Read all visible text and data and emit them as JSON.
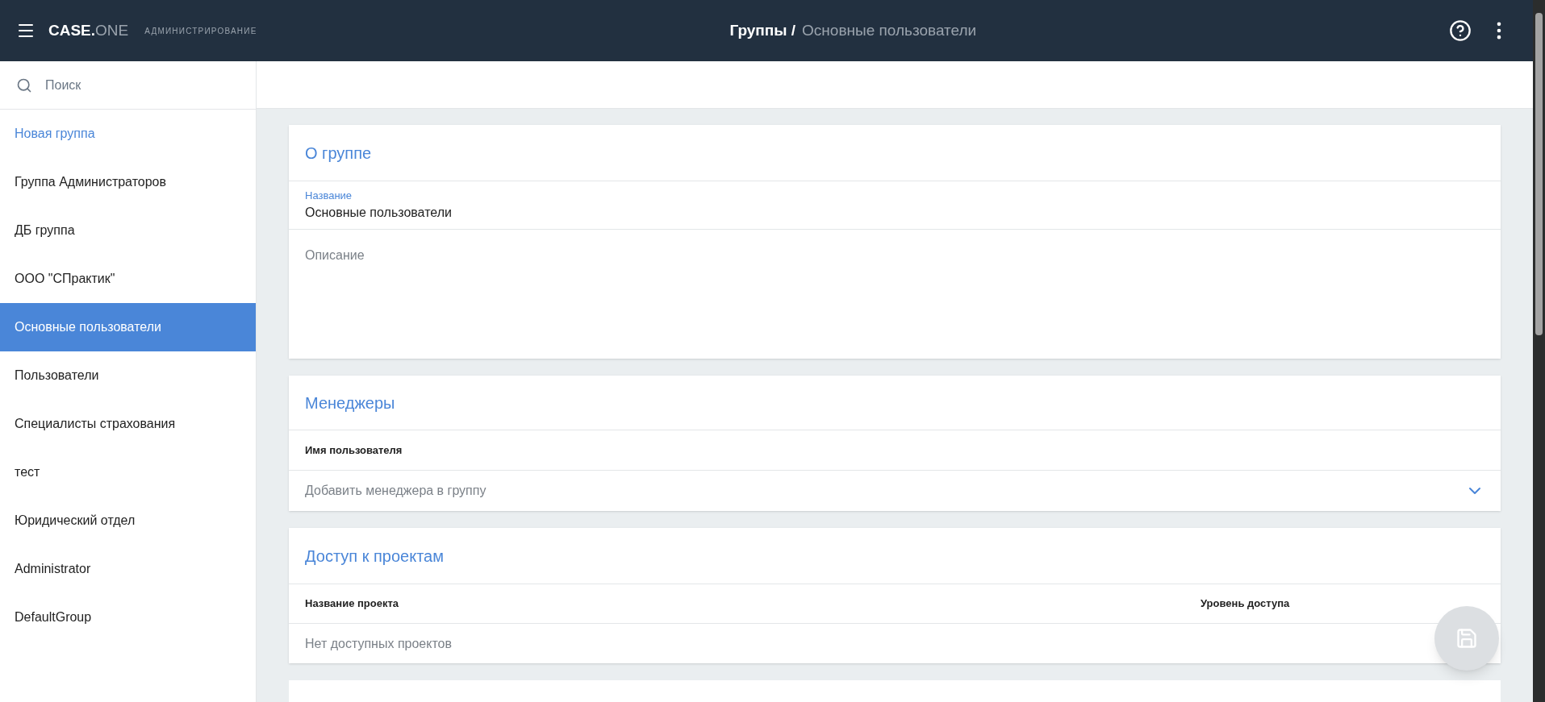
{
  "header": {
    "logo_main": "CASE.",
    "logo_accent": "ONE",
    "subtitle": "АДМИНИСТРИРОВАНИЕ",
    "breadcrumb_parent": "Группы /",
    "breadcrumb_current": "Основные пользователи"
  },
  "sidebar": {
    "search": {
      "placeholder": "Поиск"
    },
    "new_group": "Новая группа",
    "groups": [
      {
        "label": "Группа Администраторов",
        "selected": false
      },
      {
        "label": "ДБ группа",
        "selected": false
      },
      {
        "label": "ООО \"СПрактик\"",
        "selected": false
      },
      {
        "label": "Основные пользователи",
        "selected": true
      },
      {
        "label": "Пользователи",
        "selected": false
      },
      {
        "label": "Специалисты страхования",
        "selected": false
      },
      {
        "label": "тест",
        "selected": false
      },
      {
        "label": "Юридический отдел",
        "selected": false
      },
      {
        "label": "Administrator",
        "selected": false
      },
      {
        "label": "DefaultGroup",
        "selected": false
      }
    ]
  },
  "about": {
    "title": "О группе",
    "name_label": "Название",
    "name_value": "Основные пользователи",
    "description": {
      "placeholder": "Описание"
    }
  },
  "managers": {
    "title": "Менеджеры",
    "column": "Имя пользователя",
    "add": {
      "placeholder": "Добавить менеджера в группу"
    }
  },
  "projects": {
    "title": "Доступ к проектам",
    "columns": [
      "Название проекта",
      "Уровень доступа"
    ],
    "empty": "Нет доступных проектов"
  }
}
